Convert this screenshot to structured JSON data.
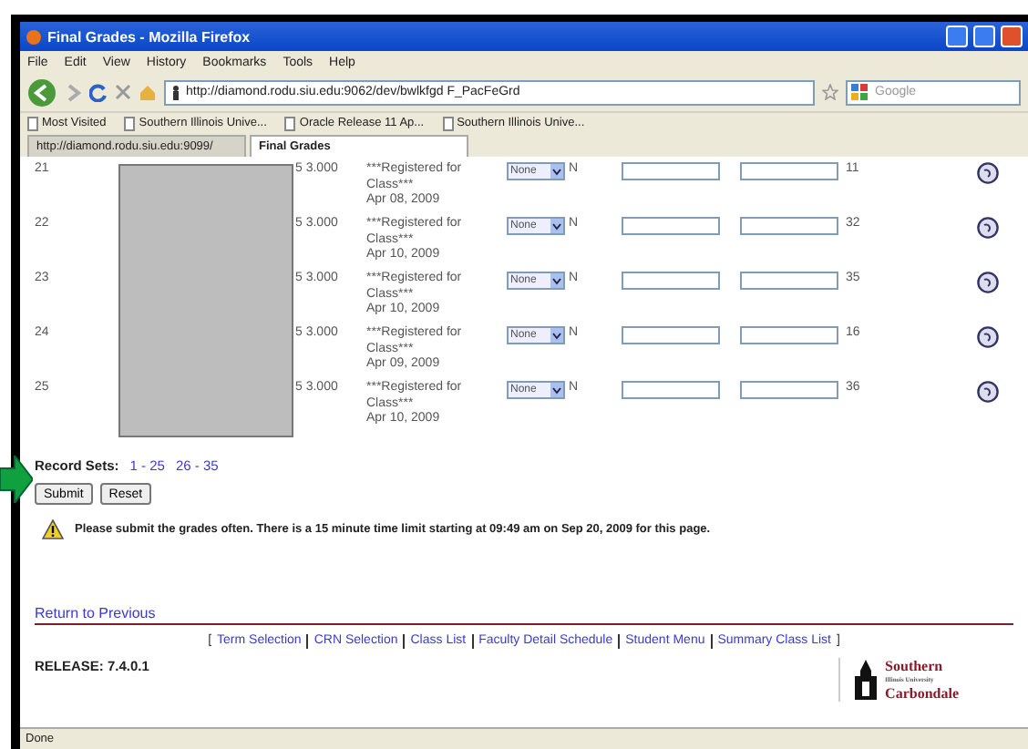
{
  "window": {
    "title": "Final Grades - Mozilla Firefox"
  },
  "menu": [
    "File",
    "Edit",
    "View",
    "History",
    "Bookmarks",
    "Tools",
    "Help"
  ],
  "address_bar": {
    "value": "http://diamond.rodu.siu.edu:9062/dev/bwlkfgd F_PacFeGrd"
  },
  "search": {
    "placeholder": "Google"
  },
  "bookmarks": [
    "Most Visited",
    "Southern Illinois Unive...",
    "Oracle Release 11 Ap...",
    "Southern Illinois Unive..."
  ],
  "tabs": [
    {
      "label": "http://diamond.rodu.siu.edu:9099/",
      "selected": false
    },
    {
      "label": "Final Grades",
      "selected": true
    }
  ],
  "rows": [
    {
      "number": "21",
      "credits": "5 3.000",
      "status": "***Registered for Class***",
      "date": "Apr 08, 2009",
      "grade": "None",
      "flag": "N",
      "hours": "11"
    },
    {
      "number": "22",
      "credits": "5 3.000",
      "status": "***Registered for Class***",
      "date": "Apr 10, 2009",
      "grade": "None",
      "flag": "N",
      "hours": "32"
    },
    {
      "number": "23",
      "credits": "5 3.000",
      "status": "***Registered for Class***",
      "date": "Apr 10, 2009",
      "grade": "None",
      "flag": "N",
      "hours": "35"
    },
    {
      "number": "24",
      "credits": "5 3.000",
      "status": "***Registered for Class***",
      "date": "Apr 09, 2009",
      "grade": "None",
      "flag": "N",
      "hours": "16"
    },
    {
      "number": "25",
      "credits": "5 3.000",
      "status": "***Registered for Class***",
      "date": "Apr 10, 2009",
      "grade": "None",
      "flag": "N",
      "hours": "36"
    }
  ],
  "record_sets": {
    "label": "Record Sets:",
    "links": [
      "1 - 25",
      "26 - 35"
    ]
  },
  "buttons": [
    "Submit",
    "Reset"
  ],
  "warning": "Please submit the grades often. There is a 15 minute time limit starting at 09:49 am on Sep 20, 2009 for this page.",
  "return_link": "Return to Previous",
  "nav_links": {
    "open": "[",
    "close": "]",
    "links": [
      "Term Selection",
      "CRN Selection",
      "Class List",
      "Faculty Detail Schedule",
      "Student Menu",
      "Summary Class List"
    ]
  },
  "release": "RELEASE: 7.4.0.1",
  "logo": {
    "name": "Southern",
    "sub": "Illinois University",
    "place": "Carbondale"
  },
  "status_bar": "Done"
}
